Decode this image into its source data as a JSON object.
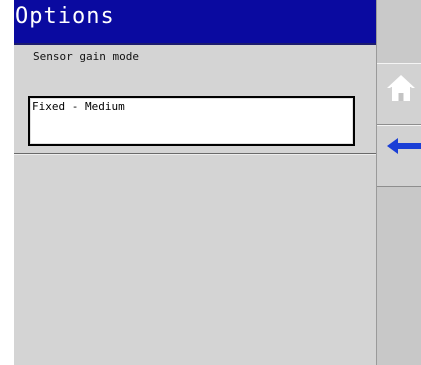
{
  "screen": {
    "title": "Options"
  },
  "setting": {
    "label": "Sensor gain mode",
    "value": "Fixed - Medium"
  },
  "side_buttons": [
    {
      "icon": "home-icon",
      "color": "#ffffff"
    },
    {
      "icon": "back-arrow-icon",
      "color": "#1a3fd6"
    }
  ],
  "colors": {
    "title_bar": "#0a0aa0",
    "panel": "#d4d4d4",
    "accent_arrow": "#1a3fd6"
  }
}
